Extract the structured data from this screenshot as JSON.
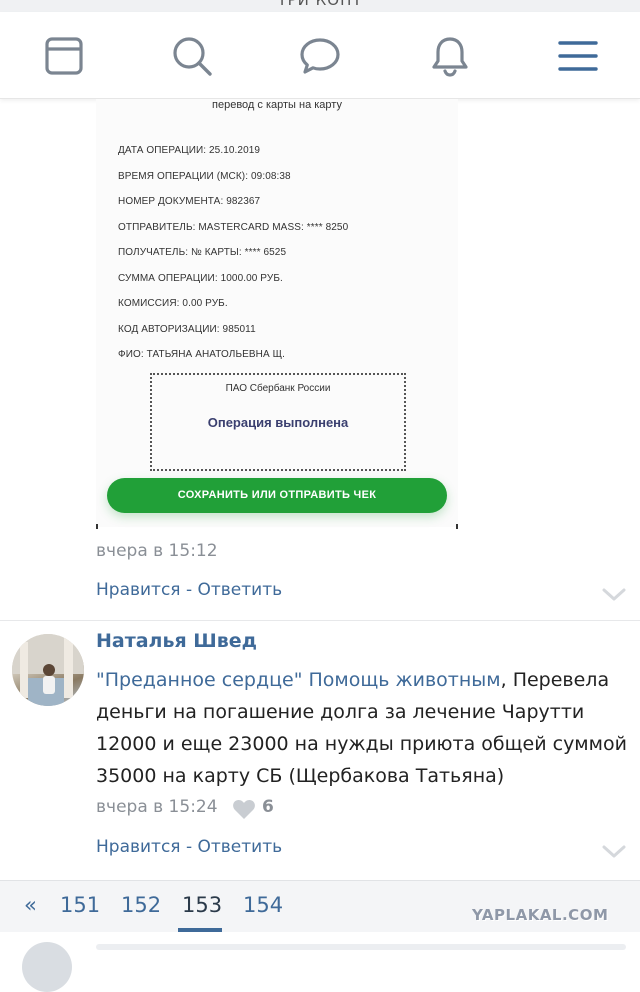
{
  "top_header": {
    "title": "ТРИ КОНТ"
  },
  "nav": {
    "items": [
      {
        "name": "feed",
        "icon": "feed-icon"
      },
      {
        "name": "search",
        "icon": "search-icon"
      },
      {
        "name": "messages",
        "icon": "chat-icon"
      },
      {
        "name": "notifications",
        "icon": "bell-icon"
      },
      {
        "name": "menu",
        "icon": "menu-icon"
      }
    ],
    "icon_color": "#7b8591",
    "accent_color": "#3f6a99"
  },
  "receipt": {
    "title": "перевод с карты на карту",
    "lines": [
      "ДАТА ОПЕРАЦИИ: 25.10.2019",
      "ВРЕМЯ ОПЕРАЦИИ (МСК): 09:08:38",
      "НОМЕР ДОКУМЕНТА: 982367",
      "ОТПРАВИТЕЛЬ: MASTERCARD MASS: **** 8250",
      "ПОЛУЧАТЕЛЬ: № КАРТЫ: **** 6525",
      "СУММА ОПЕРАЦИИ: 1000.00 РУБ.",
      "КОМИССИЯ: 0.00 РУБ.",
      "КОД АВТОРИЗАЦИИ: 985011",
      "ФИО: ТАТЬЯНА АНАТОЛЬЕВНА Щ."
    ],
    "stamp_bank": "ПАО Сбербанк России",
    "stamp_status": "Операция выполнена",
    "save_button": "СОХРАНИТЬ ИЛИ ОТПРАВИТЬ ЧЕК",
    "save_button_color": "#21a038"
  },
  "comment1": {
    "time": "вчера в 15:12",
    "actions": "Нравится - Ответить"
  },
  "comment2": {
    "author": "Наталья Швед",
    "link_text": "\"Преданное сердце\" Помощь животным",
    "text": ", Перевела деньги на погашение долга за лечение Чарутти 12000 и еще 23000 на нужды приюта общей суммой 35000 на карту СБ (Щербакова Татьяна)",
    "time": "вчера в 15:24",
    "likes": "6",
    "actions": "Нравится - Ответить"
  },
  "pagination": {
    "prev": "«",
    "pages": [
      "151",
      "152",
      "153",
      "154"
    ],
    "current": "153"
  },
  "watermark": "YAPLAKAL.COM"
}
